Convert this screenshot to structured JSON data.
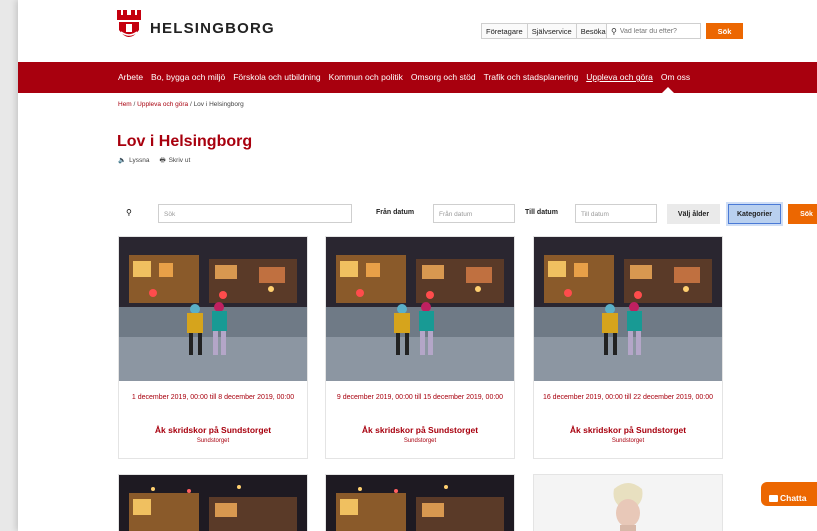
{
  "header": {
    "brand": "HELSINGBORG",
    "links": [
      "Företagare",
      "Självservice",
      "Besökare"
    ],
    "search_placeholder": "Vad letar du efter?",
    "search_button": "Sök"
  },
  "nav": {
    "items": [
      "Arbete",
      "Bo, bygga och miljö",
      "Förskola och utbildning",
      "Kommun och politik",
      "Omsorg och stöd",
      "Trafik och stadsplanering",
      "Uppleva och göra",
      "Om oss"
    ],
    "active": "Uppleva och göra"
  },
  "breadcrumb": {
    "home": "Hem",
    "parent": "Uppleva och göra",
    "current": "Lov i Helsingborg",
    "separator": "/"
  },
  "page": {
    "title": "Lov i Helsingborg",
    "listen": "Lyssna",
    "print": "Skriv ut"
  },
  "filters": {
    "search_placeholder": "Sök",
    "from_label": "Från datum",
    "from_placeholder": "Från datum",
    "to_label": "Till datum",
    "to_placeholder": "Till datum",
    "age_button": "Välj ålder",
    "category_button": "Kategorier",
    "search_button": "Sök"
  },
  "events": [
    {
      "date": "1 december 2019, 00:00 till 8 december 2019, 00:00",
      "title": "Åk skridskor på Sundstorget",
      "location": "Sundstorget"
    },
    {
      "date": "9 december 2019, 00:00 till 15 december 2019, 00:00",
      "title": "Åk skridskor på Sundstorget",
      "location": "Sundstorget"
    },
    {
      "date": "16 december 2019, 00:00 till 22 december 2019, 00:00",
      "title": "Åk skridskor på Sundstorget",
      "location": "Sundstorget"
    }
  ],
  "chat": {
    "label": "Chatta"
  },
  "colors": {
    "brand_red": "#a8000e",
    "accent_orange": "#ec6701"
  }
}
